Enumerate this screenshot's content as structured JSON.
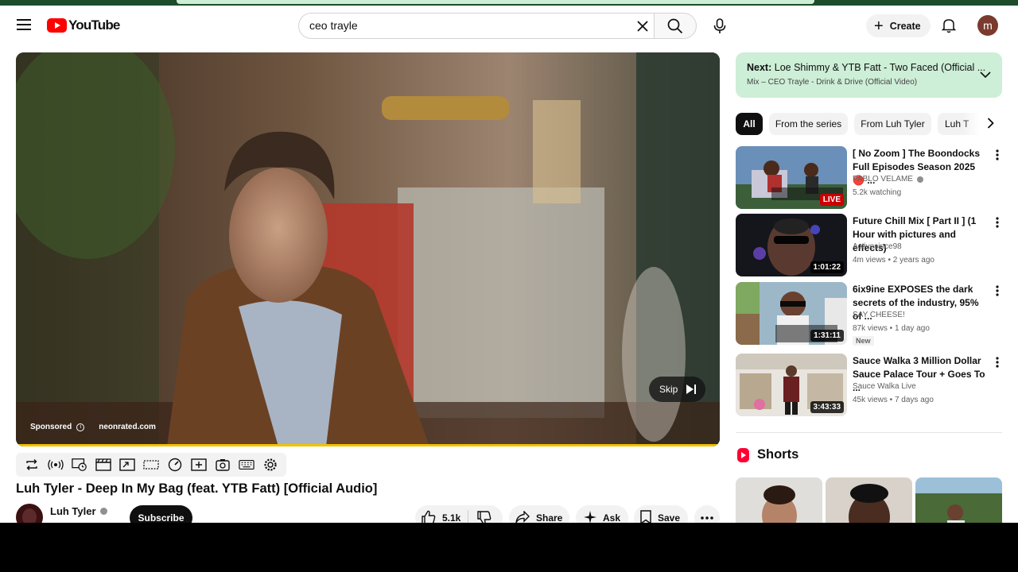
{
  "header": {
    "logo_text": "YouTube",
    "search_value": "ceo trayle",
    "create_label": "Create",
    "avatar_letter": "m"
  },
  "player": {
    "sponsored_label": "Sponsored",
    "ad_domain": "neonrated.com",
    "skip_label": "Skip"
  },
  "toolbar": {
    "icons": [
      "loop-icon",
      "broadcast-icon",
      "watch-later-icon",
      "clapper-icon",
      "picture-in-picture-icon",
      "theater-icon",
      "speed-icon",
      "add-to-queue-icon",
      "screenshot-icon",
      "keyboard-icon",
      "settings-icon"
    ]
  },
  "video": {
    "title": "Luh Tyler - Deep In My Bag (feat. YTB Fatt) [Official Audio]",
    "channel": "Luh Tyler",
    "subscribe_label": "Subscribe",
    "likes": "5.1k",
    "share_label": "Share",
    "ask_label": "Ask",
    "save_label": "Save"
  },
  "next": {
    "prefix": "Next:",
    "title": "Loe Shimmy & YTB Fatt - Two Faced (Official ...",
    "subtitle": "Mix – CEO Trayle - Drink & Drive (Official Video)"
  },
  "chips": [
    "All",
    "From the series",
    "From Luh Tyler",
    "Luh T"
  ],
  "recommendations": [
    {
      "title": "[ No Zoom ] The Boondocks Full Episodes Season 2025 🔴 ...",
      "channel": "PABLO VELAME",
      "verified": true,
      "meta": "5.2k watching",
      "badge": "LIVE",
      "new": ""
    },
    {
      "title": "Future Chill Mix [ Part II ] (1 Hour with pictures and effects)",
      "channel": "Activesince98",
      "verified": false,
      "meta": "4m views • 2 years ago",
      "badge": "1:01:22",
      "new": ""
    },
    {
      "title": "6ix9ine EXPOSES the dark secrets of the industry, 95% of ...",
      "channel": "SAY CHEESE!",
      "verified": false,
      "meta": "87k views • 1 day ago",
      "badge": "1:31:11",
      "new": "New"
    },
    {
      "title": "Sauce Walka 3 Million Dollar Sauce Palace Tour + Goes To ...",
      "channel": "Sauce Walka Live",
      "verified": false,
      "meta": "45k views • 7 days ago",
      "badge": "3:43:33",
      "new": ""
    }
  ],
  "shorts": {
    "title": "Shorts"
  },
  "colors": {
    "brand_red": "#ff0000",
    "next_bg": "#cdeed7",
    "progress": "#f2c200"
  }
}
